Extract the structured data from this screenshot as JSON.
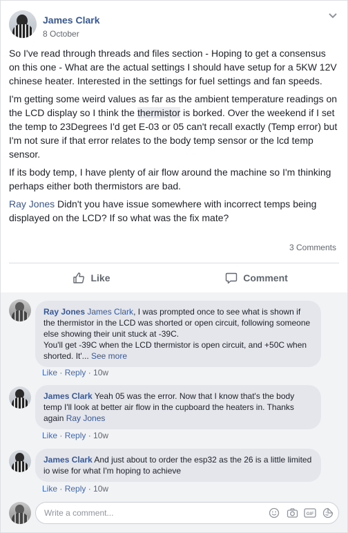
{
  "post": {
    "author": "James Clark",
    "date": "8 October",
    "paragraphs": {
      "p1": "So I've read through threads and files section - Hoping to get a consensus on this one - What are the actual settings I should have setup for a 5KW 12V chinese heater. Interested in the settings for fuel settings and fan speeds.",
      "p2_a": "I'm getting some weird values as far as the ambient temperature readings on the LCD display so I think the ",
      "p2_thermistor": "thermistor",
      "p2_b": " is borked. Over the weekend if I set the temp to 23Degrees I'd get E-03 or 05 can't recall exactly (Temp error) but I'm not sure if that error relates to the body temp sensor or the lcd temp sensor.",
      "p3": "If its body temp, I have plenty of air flow around the machine so I'm thinking perhaps either both thermistors are bad.",
      "p4_mention": "Ray Jones",
      "p4_text": " Didn't you have issue somewhere with incorrect temps being displayed on the LCD? If so what was the fix mate?"
    },
    "comments_count": "3 Comments",
    "actions": {
      "like": "Like",
      "comment": "Comment"
    }
  },
  "comments": [
    {
      "author": "Ray Jones",
      "mention": "James Clark",
      "text": ", I was prompted once to see what is shown if the thermistor in the LCD was shorted or open circuit, following someone else showing their unit stuck at -39C.",
      "text2": "You'll get -39C when the LCD thermistor is open circuit, and +50C when shorted. It'...",
      "see_more": "See more",
      "like": "Like",
      "reply": "Reply",
      "time": "10w"
    },
    {
      "author": "James Clark",
      "text": "Yeah 05 was the error. Now that I know that's the body temp I'll look at better air flow in the cupboard the heaters in. Thanks again ",
      "mention": "Ray Jones",
      "like": "Like",
      "reply": "Reply",
      "time": "10w"
    },
    {
      "author": "James Clark",
      "text": "And just about to order the esp32 as the 26 is a little limited io wise for what I'm hoping to achieve",
      "like": "Like",
      "reply": "Reply",
      "time": "10w"
    }
  ],
  "composer": {
    "placeholder": "Write a comment..."
  },
  "sep": " · "
}
